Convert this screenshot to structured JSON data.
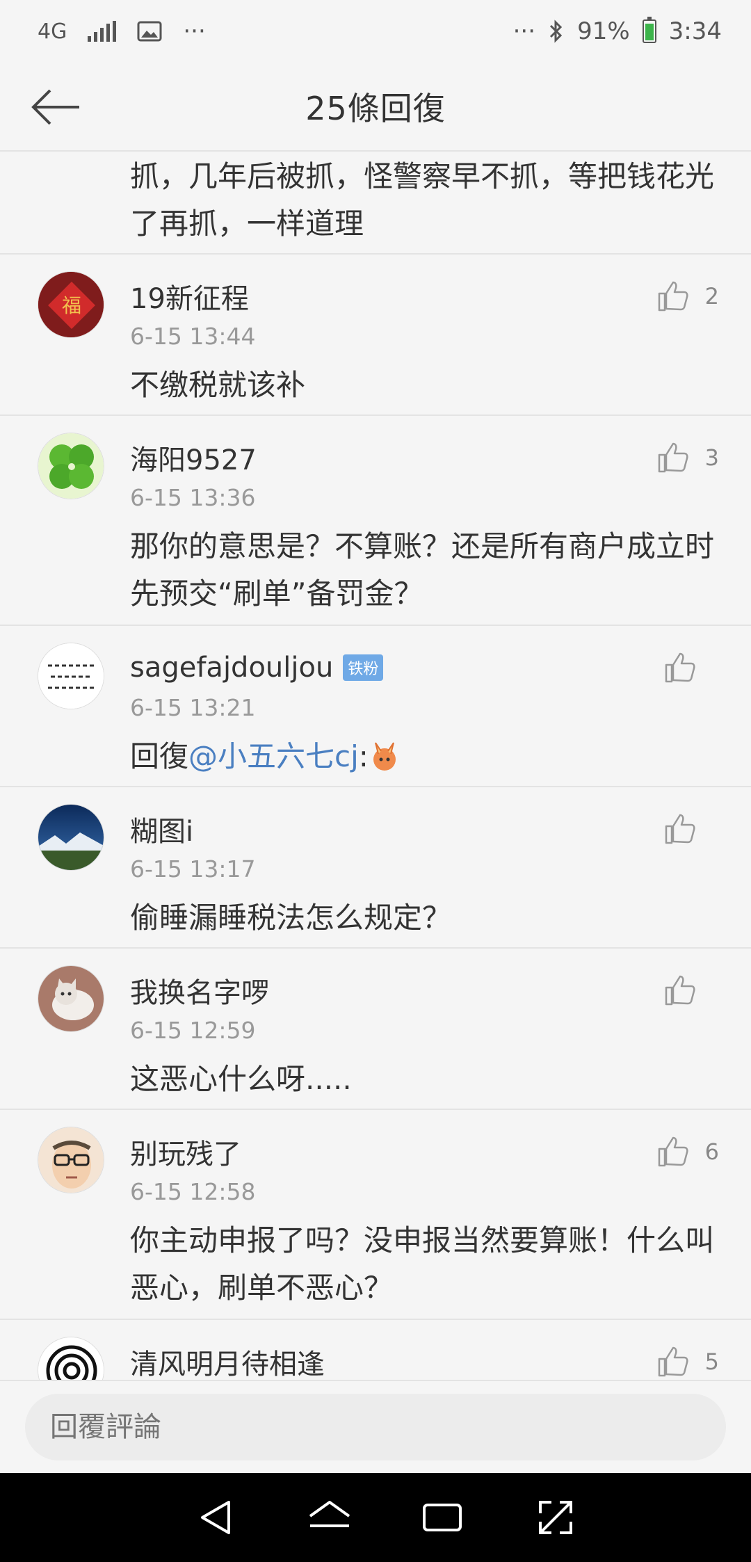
{
  "status_bar": {
    "network": "4G",
    "battery": "91%",
    "time": "3:34",
    "icons": [
      "signal-icon",
      "image-icon",
      "more-icon",
      "bluetooth-icon",
      "battery-icon"
    ]
  },
  "header": {
    "title": "25條回復",
    "back_icon": "arrow-left-icon"
  },
  "partial_comment": {
    "line1": "抓，几年后被抓，怪警察早不抓，等把钱花光",
    "line2": "了再抓，一样道理"
  },
  "comments": [
    {
      "name": "19新征程",
      "time": "6-15 13:44",
      "text": "不缴税就该补",
      "likes": "2"
    },
    {
      "name": "海阳9527",
      "time": "6-15 13:36",
      "text": "那你的意思是？不算账？还是所有商户成立时先预交“刷单”备罚金？",
      "likes": "3"
    },
    {
      "name": "sagefajdouljou",
      "badge": "铁粉",
      "time": "6-15 13:21",
      "text_prefix": "回復",
      "mention": "@小五六七cj",
      "text_suffix": ":",
      "likes": ""
    },
    {
      "name": "糊图i",
      "time": "6-15 13:17",
      "text": "偷睡漏睡税法怎么规定？",
      "likes": ""
    },
    {
      "name": "我换名字啰",
      "time": "6-15 12:59",
      "text": "这恶心什么呀.....",
      "likes": ""
    },
    {
      "name": "别玩残了",
      "time": "6-15 12:58",
      "text": "你主动申报了吗？没申报当然要算账！什么叫恶心，刷单不恶心？",
      "likes": "6"
    },
    {
      "name": "清风明月待相逢",
      "time": "",
      "text": "",
      "likes": "5"
    }
  ],
  "reply_bar": {
    "placeholder": "回覆評論"
  },
  "colors": {
    "background": "#f5f5f5",
    "mention": "#4a7fc1",
    "badge": "#6fa9e6",
    "time": "#999999"
  }
}
